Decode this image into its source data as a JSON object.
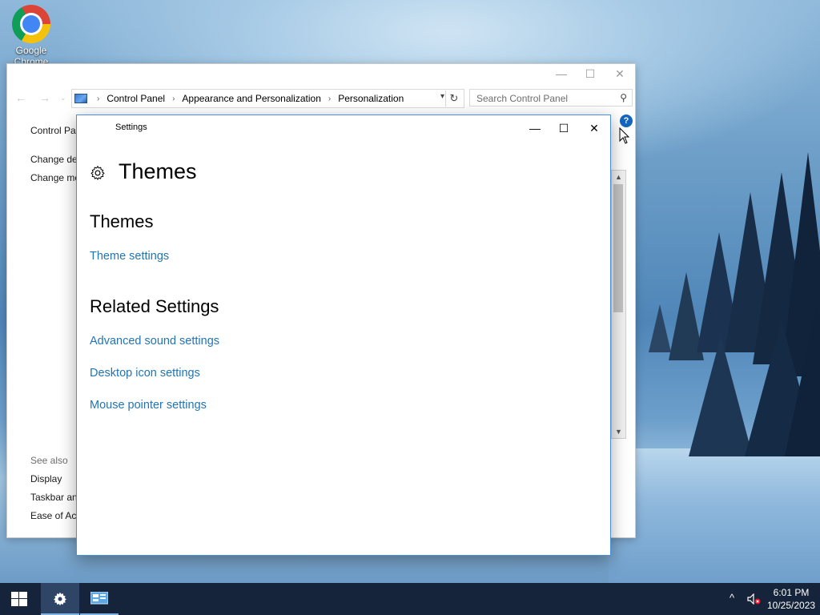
{
  "desktop": {
    "icons": [
      {
        "label": "Google Chrome"
      }
    ]
  },
  "control_panel": {
    "breadcrumbs": [
      "Control Panel",
      "Appearance and Personalization",
      "Personalization"
    ],
    "search_placeholder": "Search Control Panel",
    "left_nav": {
      "home": "Control Panel Home",
      "links": [
        "Change desktop icons",
        "Change mouse pointers"
      ],
      "see_also_label": "See also",
      "see_also": [
        "Display",
        "Taskbar and Navigation",
        "Ease of Access Center"
      ]
    },
    "help_glyph": "?"
  },
  "settings": {
    "window_title": "Settings",
    "page_title": "Themes",
    "sections": [
      {
        "heading": "Themes",
        "links": [
          "Theme settings"
        ]
      },
      {
        "heading": "Related Settings",
        "links": [
          "Advanced sound settings",
          "Desktop icon settings",
          "Mouse pointer settings"
        ]
      }
    ]
  },
  "taskbar": {
    "items": [
      {
        "icon": "windows-start-icon"
      },
      {
        "icon": "settings-gear-icon",
        "active": true
      },
      {
        "icon": "control-panel-icon",
        "open": true
      }
    ],
    "tray": {
      "time": "6:01 PM",
      "date": "10/25/2023"
    }
  },
  "colors": {
    "link": "#2374b2",
    "taskbar": "#15243a",
    "accent": "#4a90d9"
  }
}
